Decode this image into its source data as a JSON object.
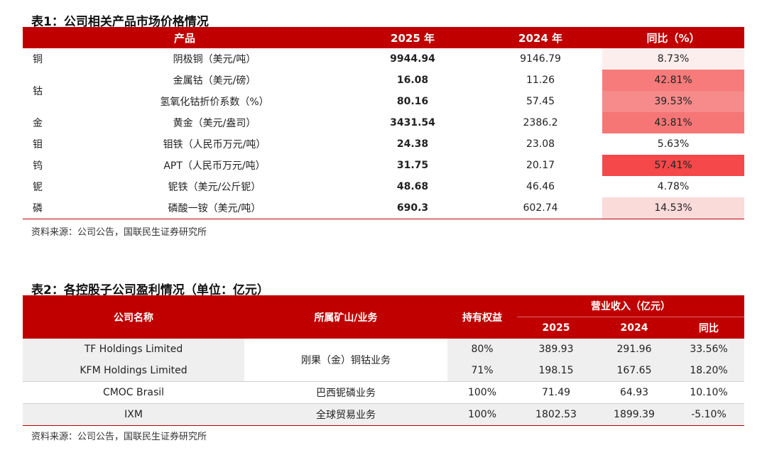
{
  "table1": {
    "title": "表1：公司相关产品市场价格情况",
    "headers": [
      "产品",
      "2025 年",
      "2024 年",
      "同比（%）"
    ],
    "rows": [
      {
        "metal": "铜",
        "product": "阴极铜（美元/吨）",
        "v2025": "9944.94",
        "v2024": "9146.79",
        "yoy": "8.73%",
        "heat_color": "#fdeeee"
      },
      {
        "metal": "钴",
        "product": "金属钴（美元/磅）",
        "v2025": "16.08",
        "v2024": "11.26",
        "yoy": "42.81%",
        "heat_color": "#f77b7b"
      },
      {
        "metal": "",
        "product": "氢氧化钴折价系数（%）",
        "v2025": "80.16",
        "v2024": "57.45",
        "yoy": "39.53%",
        "heat_color": "#f78a8a"
      },
      {
        "metal": "金",
        "product": "黄金（美元/盎司）",
        "v2025": "3431.54",
        "v2024": "2386.2",
        "yoy": "43.81%",
        "heat_color": "#f67676"
      },
      {
        "metal": "钼",
        "product": "钼铁（人民币万元/吨）",
        "v2025": "24.38",
        "v2024": "23.08",
        "yoy": "5.63%",
        "heat_color": "#ffffff"
      },
      {
        "metal": "钨",
        "product": "APT（人民币万元/吨）",
        "v2025": "31.75",
        "v2024": "20.17",
        "yoy": "57.41%",
        "heat_color": "#f4484a"
      },
      {
        "metal": "铌",
        "product": "铌铁（美元/公斤铌）",
        "v2025": "48.68",
        "v2024": "46.46",
        "yoy": "4.78%",
        "heat_color": "#ffffff"
      },
      {
        "metal": "磷",
        "product": "磷酸一铵（美元/吨）",
        "v2025": "690.3",
        "v2024": "602.74",
        "yoy": "14.53%",
        "heat_color": "#fbdada"
      }
    ],
    "source": "资料来源：公司公告，国联民生证券研究所"
  },
  "table2": {
    "title": "表2：各控股子公司盈利情况（单位：亿元）",
    "headers": {
      "company": "公司名称",
      "business": "所属矿山/业务",
      "stake": "持有权益",
      "revenue_group": "营业收入（亿元）",
      "y2025": "2025",
      "y2024": "2024",
      "yoy": "同比"
    },
    "rows": [
      {
        "company": "TF Holdings Limited",
        "business": "刚果（金）铜钴业务",
        "stake": "80%",
        "r2025": "389.93",
        "r2024": "291.96",
        "yoy": "33.56%"
      },
      {
        "company": "KFM Holdings Limited",
        "business": "",
        "stake": "71%",
        "r2025": "198.15",
        "r2024": "167.65",
        "yoy": "18.20%"
      },
      {
        "company": "CMOC Brasil",
        "business": "巴西铌磷业务",
        "stake": "100%",
        "r2025": "71.49",
        "r2024": "64.93",
        "yoy": "10.10%"
      },
      {
        "company": "IXM",
        "business": "全球贸易业务",
        "stake": "100%",
        "r2025": "1802.53",
        "r2024": "1899.39",
        "yoy": "-5.10%"
      }
    ],
    "source": "资料来源：公司公告，国联民生证券研究所"
  }
}
